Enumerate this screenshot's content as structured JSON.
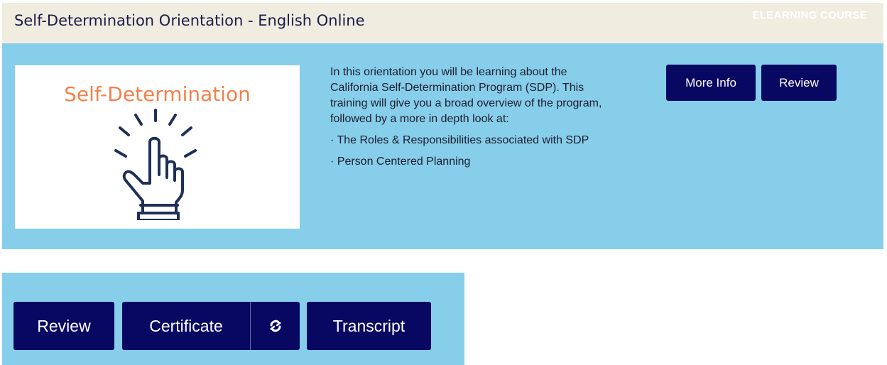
{
  "course": {
    "title": "Self-Determination Orientation - English Online",
    "type_label": "ELEARNING COURSE",
    "thumbnail_text": "Self-Determination",
    "description": [
      "In this orientation you will be learning about the California Self-Determination Program (SDP). This training will give you a broad overview of the program, followed by a more in depth look at:",
      "· The Roles & Responsibilities associated with SDP",
      "· Person Centered Planning"
    ],
    "more_info_label": "More Info",
    "review_label": "Review"
  },
  "actions": {
    "review_label": "Review",
    "certificate_label": "Certificate",
    "refresh_icon": "refresh-icon",
    "transcript_label": "Transcript"
  },
  "colors": {
    "header_bg": "#f0ede0",
    "card_bg": "#87ceeb",
    "button_bg": "#080862",
    "thumbnail_text": "#f0824a",
    "icon_stroke": "#1e3058"
  }
}
